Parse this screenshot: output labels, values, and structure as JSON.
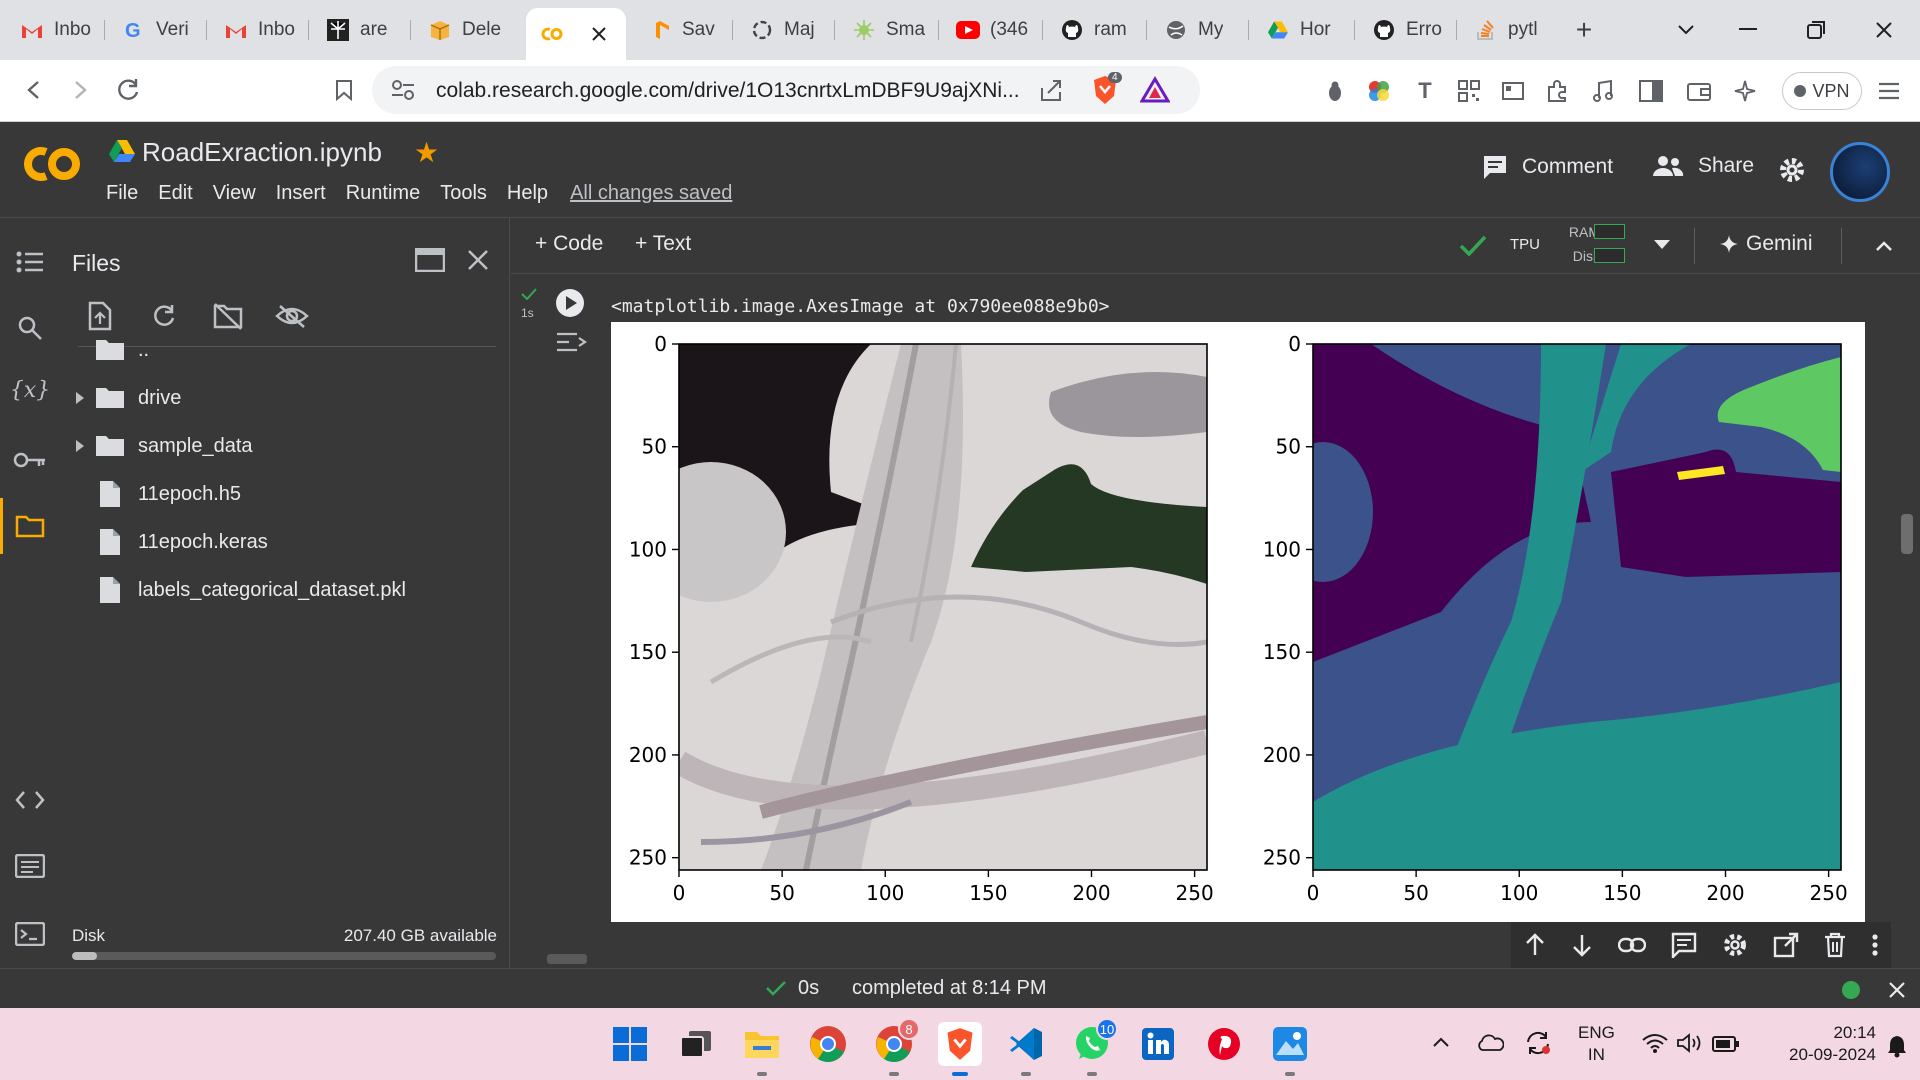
{
  "browser": {
    "tabs": [
      {
        "label": "Inbo",
        "icon": "gmail-icon"
      },
      {
        "label": "Veri",
        "icon": "google-icon"
      },
      {
        "label": "Inbo",
        "icon": "gmail-icon"
      },
      {
        "label": "are",
        "icon": "perplexity-icon"
      },
      {
        "label": "Dele",
        "icon": "box-icon"
      },
      {
        "label": "",
        "icon": "colab-icon",
        "active": true
      },
      {
        "label": "Sav",
        "icon": "tensorflow-icon"
      },
      {
        "label": "Maj",
        "icon": "openai-icon"
      },
      {
        "label": "Sma",
        "icon": "star-burst-icon"
      },
      {
        "label": "(346",
        "icon": "youtube-icon"
      },
      {
        "label": "ram",
        "icon": "github-icon"
      },
      {
        "label": "My",
        "icon": "globe-icon"
      },
      {
        "label": "Hor",
        "icon": "drive-icon"
      },
      {
        "label": "Erro",
        "icon": "github-icon"
      },
      {
        "label": "pytl",
        "icon": "stackoverflow-icon"
      }
    ],
    "url": "colab.research.google.com/drive/1O13cnrtxLmDBF9U9ajXNi...",
    "brave_badge": "4",
    "vpn_label": "VPN"
  },
  "colab": {
    "title": "RoadExraction.ipynb",
    "menu": [
      "File",
      "Edit",
      "View",
      "Insert",
      "Runtime",
      "Tools",
      "Help"
    ],
    "saved_status": "All changes saved",
    "comment_label": "Comment",
    "share_label": "Share",
    "add_code": "+ Code",
    "add_text": "+ Text",
    "runtime_type": "TPU",
    "ram_label": "RAM",
    "disk_label": "Disk",
    "gemini_label": "Gemini"
  },
  "files_panel": {
    "title": "Files",
    "items": [
      {
        "name": "..",
        "type": "folder",
        "expandable": false
      },
      {
        "name": "drive",
        "type": "folder",
        "expandable": true
      },
      {
        "name": "sample_data",
        "type": "folder",
        "expandable": true
      },
      {
        "name": "11epoch.h5",
        "type": "file",
        "expandable": false
      },
      {
        "name": "11epoch.keras",
        "type": "file",
        "expandable": false
      },
      {
        "name": "labels_categorical_dataset.pkl",
        "type": "file",
        "expandable": false
      }
    ],
    "disk_label": "Disk",
    "disk_available": "207.40 GB available",
    "disk_used_fraction": 0.06
  },
  "cell": {
    "exec_time": "1s",
    "output_text": "<matplotlib.image.AxesImage at 0x790ee088e9b0>"
  },
  "plots": {
    "x_ticks": [
      "0",
      "50",
      "100",
      "150",
      "200",
      "250"
    ],
    "y_ticks": [
      "0",
      "50",
      "100",
      "150",
      "200",
      "250"
    ],
    "colors": {
      "mask_bg": "#440154",
      "mask_land": "#3b528b",
      "mask_road": "#21918c",
      "mask_veg": "#5ec962",
      "mask_misc": "#fde725"
    }
  },
  "statusbar": {
    "elapsed": "0s",
    "completed": "completed at 8:14 PM"
  },
  "taskbar": {
    "chrome_badge": "8",
    "whatsapp_badge": "10",
    "lang_line1": "ENG",
    "lang_line2": "IN",
    "time": "20:14",
    "date": "20-09-2024"
  }
}
